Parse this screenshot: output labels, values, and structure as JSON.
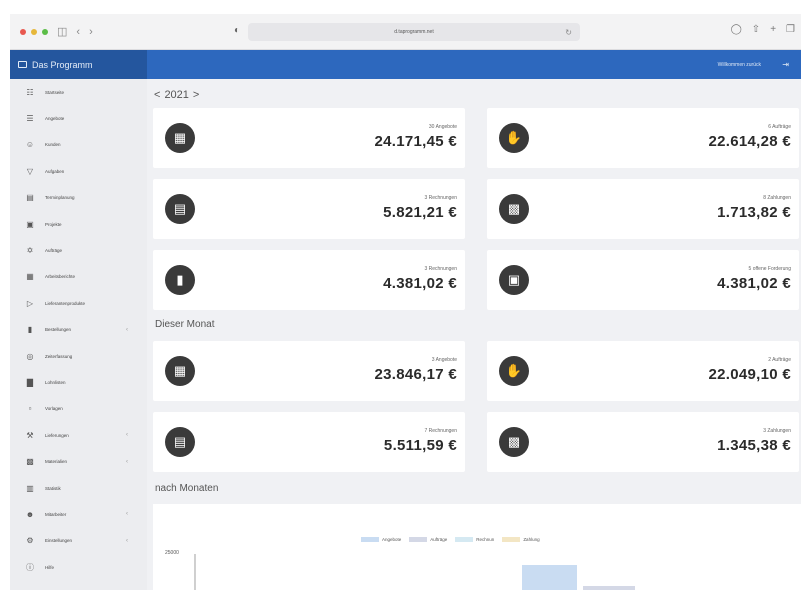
{
  "browser": {
    "url": "d.taprogramm.net",
    "nav": [
      "‹",
      "›"
    ]
  },
  "header": {
    "brand": "Das Programm",
    "user": "Willkommen zurück",
    "exit_icon": "logout-icon"
  },
  "sidebar": {
    "items": [
      {
        "label": "Startseite",
        "icon": "dashboard-icon",
        "glyph": "☷",
        "chevron": false
      },
      {
        "label": "Angebote",
        "icon": "list-icon",
        "glyph": "☰",
        "chevron": false
      },
      {
        "label": "Kunden",
        "icon": "user-icon",
        "glyph": "☺",
        "chevron": false
      },
      {
        "label": "Aufgaben",
        "icon": "filter-icon",
        "glyph": "▽",
        "chevron": false
      },
      {
        "label": "Terminplanung",
        "icon": "calendar-icon",
        "glyph": "▤",
        "chevron": false
      },
      {
        "label": "Projekte",
        "icon": "folder-icon",
        "glyph": "▣",
        "chevron": false
      },
      {
        "label": "Aufträge",
        "icon": "handshake-icon",
        "glyph": "✡",
        "chevron": false
      },
      {
        "label": "Arbeitsberichte",
        "icon": "table-icon",
        "glyph": "▦",
        "chevron": false
      },
      {
        "label": "Lieferantenprodukte",
        "icon": "truck-icon",
        "glyph": "▷",
        "chevron": false
      },
      {
        "label": "Bestellungen",
        "icon": "cart-icon",
        "glyph": "▮",
        "chevron": true
      },
      {
        "label": "Zeiterfassung",
        "icon": "clock-icon",
        "glyph": "◎",
        "chevron": false
      },
      {
        "label": "Lohnlisten",
        "icon": "chart-icon",
        "glyph": "▇",
        "chevron": false
      },
      {
        "label": "Vorlagen",
        "icon": "document-icon",
        "glyph": "▫",
        "chevron": false
      },
      {
        "label": "Lieferungen",
        "icon": "box-icon",
        "glyph": "⚒",
        "chevron": true
      },
      {
        "label": "Materialien",
        "icon": "grid-icon",
        "glyph": "▩",
        "chevron": true
      },
      {
        "label": "Statistik",
        "icon": "stats-icon",
        "glyph": "▥",
        "chevron": false
      },
      {
        "label": "Mitarbeiter",
        "icon": "team-icon",
        "glyph": "☻",
        "chevron": true
      },
      {
        "label": "Einstellungen",
        "icon": "settings-icon",
        "glyph": "⚙",
        "chevron": true
      },
      {
        "label": "Hilfe",
        "icon": "help-icon",
        "glyph": "ⓘ",
        "chevron": false
      }
    ]
  },
  "main": {
    "year": "2021",
    "prev": "<",
    "next": ">",
    "year_cards": [
      {
        "label": "30 Angebote",
        "value": "24.171,45 €",
        "icon": "calculator-icon",
        "glyph": "▦"
      },
      {
        "label": "6 Aufträge",
        "value": "22.614,28 €",
        "icon": "handshake-icon",
        "glyph": "✋"
      },
      {
        "label": "3 Rechnungen",
        "value": "5.821,21 €",
        "icon": "invoice-icon",
        "glyph": "▤"
      },
      {
        "label": "8 Zahlungen",
        "value": "1.713,82 €",
        "icon": "cash-register-icon",
        "glyph": "▩"
      },
      {
        "label": "3 Rechnungen",
        "value": "4.381,02 €",
        "icon": "thermometer-icon",
        "glyph": "▮"
      },
      {
        "label": "5 offene Forderung",
        "value": "4.381,02 €",
        "icon": "calendar-icon",
        "glyph": "▣"
      }
    ],
    "month_title": "Dieser Monat",
    "month_cards": [
      {
        "label": "3 Angebote",
        "value": "23.846,17 €",
        "icon": "calculator-icon",
        "glyph": "▦"
      },
      {
        "label": "2 Aufträge",
        "value": "22.049,10 €",
        "icon": "handshake-icon",
        "glyph": "✋"
      },
      {
        "label": "7 Rechnungen",
        "value": "5.511,59 €",
        "icon": "invoice-icon",
        "glyph": "▤"
      },
      {
        "label": "3 Zahlungen",
        "value": "1.345,38 €",
        "icon": "cash-register-icon",
        "glyph": "▩"
      }
    ],
    "chart_title": "nach Monaten",
    "chart_legend": [
      {
        "name": "Angebote",
        "color": "#c9dcf2"
      },
      {
        "name": "Aufträge",
        "color": "#d4d8e6"
      },
      {
        "name": "Rechnun",
        "color": "#d5e9f2"
      },
      {
        "name": "Zahlung",
        "color": "#f3e6c4"
      }
    ],
    "chart_ytick": "25000"
  }
}
